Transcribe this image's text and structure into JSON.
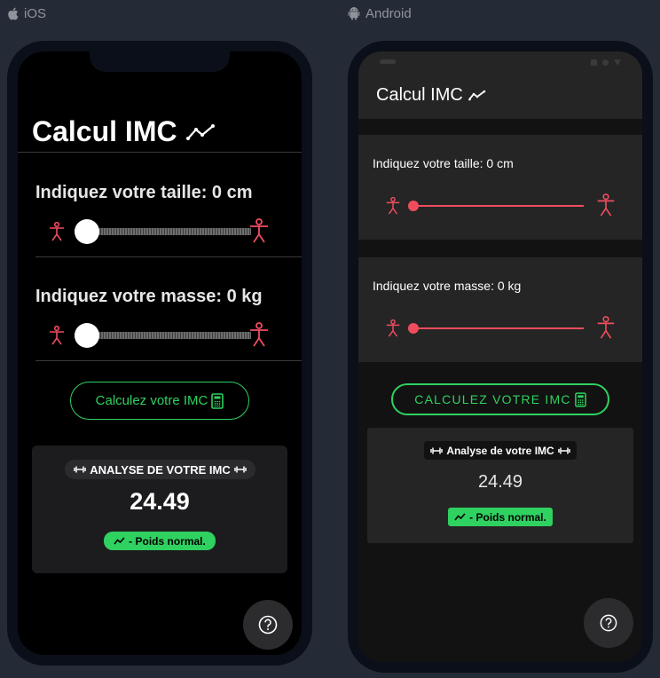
{
  "platforms": {
    "ios_label": "iOS",
    "android_label": "Android"
  },
  "colors": {
    "accent_green": "#2fd160",
    "accent_red": "#ef4d5e",
    "background": "#252b36"
  },
  "ios": {
    "title": "Calcul IMC",
    "title_icon": "trending-icon",
    "height_label": "Indiquez votre taille: 0 cm",
    "mass_label": "Indiquez votre masse: 0 kg",
    "height_value": 0,
    "mass_value": 0,
    "slider_icons": [
      "person-small-icon",
      "person-large-icon"
    ],
    "calculate_button": "Calculez votre IMC",
    "calculate_icon": "calculator-icon",
    "analysis_title": "ANALYSE DE VOTRE IMC",
    "analysis_icon": "fitness-icon",
    "bmi_value": "24.49",
    "status_text": "- Poids normal.",
    "help_icon": "help-icon"
  },
  "android": {
    "title": "Calcul IMC",
    "title_icon": "trending-icon",
    "height_label": "Indiquez votre taille: 0 cm",
    "mass_label": "Indiquez votre masse: 0 kg",
    "height_value": 0,
    "mass_value": 0,
    "slider_icons": [
      "person-small-icon",
      "person-large-icon"
    ],
    "calculate_button": "CALCULEZ VOTRE IMC",
    "calculate_icon": "calculator-icon",
    "analysis_title": "Analyse de votre IMC",
    "analysis_icon": "fitness-icon",
    "bmi_value": "24.49",
    "status_text": "- Poids normal.",
    "help_icon": "help-icon"
  }
}
